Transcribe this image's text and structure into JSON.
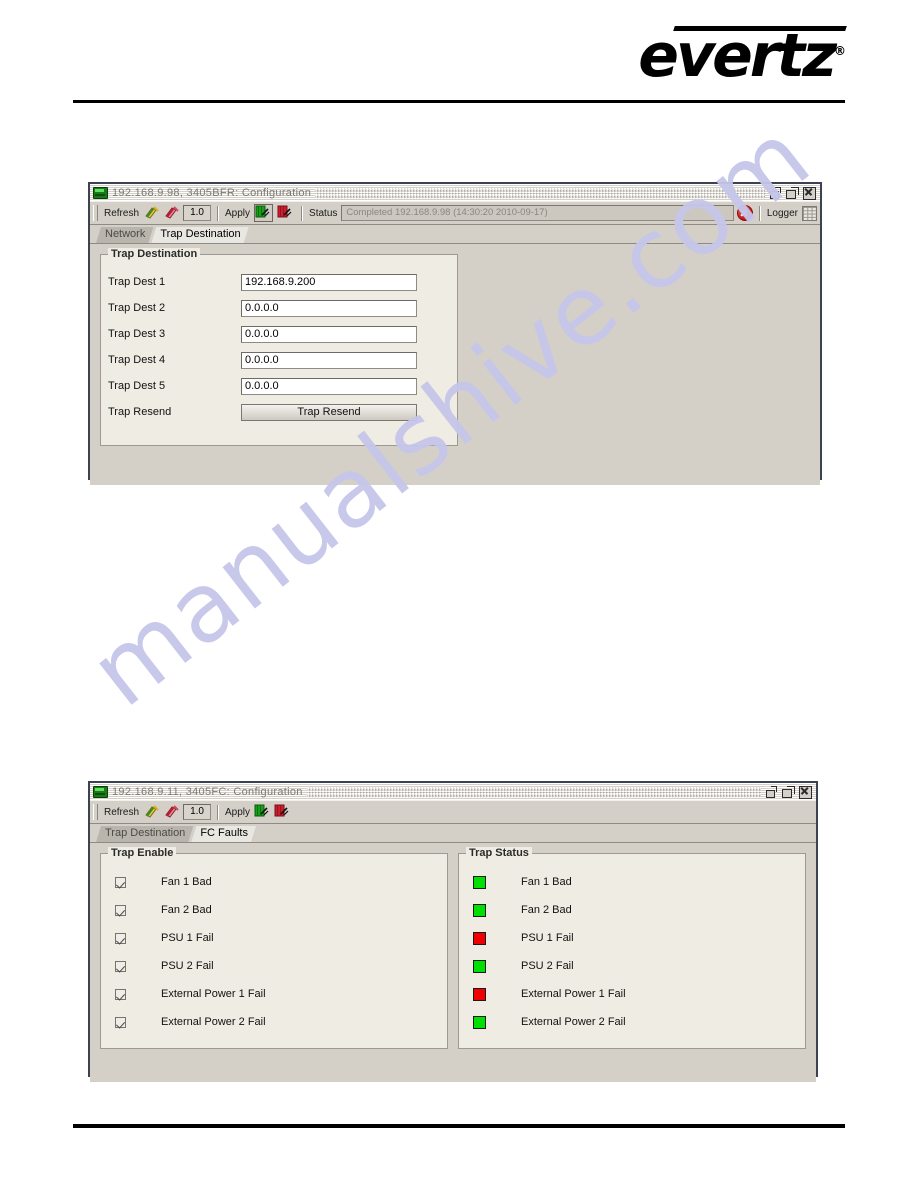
{
  "page": {
    "watermark": "manualshive.com",
    "logo_text": "evertz",
    "logo_mark": "®"
  },
  "window_one": {
    "title": "192.168.9.98, 3405BFR: Configuration",
    "app_icon": "device-icon",
    "window_buttons": [
      {
        "name": "restore-button",
        "label": "Restore"
      },
      {
        "name": "maximize-button",
        "label": "Maximize"
      },
      {
        "name": "close-button",
        "label": "Close"
      }
    ],
    "toolbar": {
      "refresh_label": "Refresh",
      "refresh_icon": "refresh-single-icon",
      "refresh_all_icon": "refresh-all-icon",
      "version_value": "1.0",
      "apply_label": "Apply",
      "apply_icon": "apply-single-icon",
      "apply_all_icon": "apply-all-icon",
      "status_label": "Status",
      "status_value": "Completed 192.168.9.98 (14:30:20  2010-09-17)",
      "stop_icon": "stop-error-icon",
      "logger_label": "Logger",
      "logger_icon": "logger-grid-icon"
    },
    "tabs": [
      {
        "label": "Network",
        "active": false
      },
      {
        "label": "Trap Destination",
        "active": true
      }
    ],
    "trap_destination": {
      "group_title": "Trap Destination",
      "rows": [
        {
          "label": "Trap Dest 1",
          "value": "192.168.9.200"
        },
        {
          "label": "Trap Dest 2",
          "value": "0.0.0.0"
        },
        {
          "label": "Trap Dest 3",
          "value": "0.0.0.0"
        },
        {
          "label": "Trap Dest 4",
          "value": "0.0.0.0"
        },
        {
          "label": "Trap Dest 5",
          "value": "0.0.0.0"
        }
      ],
      "resend_label": "Trap Resend",
      "resend_button": "Trap Resend"
    }
  },
  "window_two": {
    "title": "192.168.9.11, 3405FC: Configuration",
    "app_icon": "device-icon",
    "window_buttons": [
      {
        "name": "restore-button",
        "label": "Restore"
      },
      {
        "name": "maximize-button",
        "label": "Maximize"
      },
      {
        "name": "close-button",
        "label": "Close"
      }
    ],
    "toolbar": {
      "refresh_label": "Refresh",
      "refresh_icon": "refresh-single-icon",
      "refresh_all_icon": "refresh-all-icon",
      "version_value": "1.0",
      "apply_label": "Apply",
      "apply_icon": "apply-single-icon",
      "apply_all_icon": "apply-all-icon"
    },
    "tabs": [
      {
        "label": "Trap Destination",
        "active": false
      },
      {
        "label": "FC Faults",
        "active": true
      }
    ],
    "trap_enable": {
      "group_title": "Trap Enable",
      "items": [
        {
          "label": "Fan 1 Bad",
          "checked": true
        },
        {
          "label": "Fan 2 Bad",
          "checked": true
        },
        {
          "label": "PSU 1 Fail",
          "checked": true
        },
        {
          "label": "PSU 2 Fail",
          "checked": true
        },
        {
          "label": "External Power 1 Fail",
          "checked": true
        },
        {
          "label": "External Power 2 Fail",
          "checked": true
        }
      ]
    },
    "trap_status": {
      "group_title": "Trap Status",
      "items": [
        {
          "label": "Fan 1 Bad",
          "state": "ok",
          "color": "#00e000"
        },
        {
          "label": "Fan 2 Bad",
          "state": "ok",
          "color": "#00e000"
        },
        {
          "label": "PSU 1 Fail",
          "state": "fault",
          "color": "#ee0000"
        },
        {
          "label": "PSU 2 Fail",
          "state": "ok",
          "color": "#00e000"
        },
        {
          "label": "External Power 1 Fail",
          "state": "fault",
          "color": "#ee0000"
        },
        {
          "label": "External Power 2 Fail",
          "state": "ok",
          "color": "#00e000"
        }
      ]
    }
  }
}
